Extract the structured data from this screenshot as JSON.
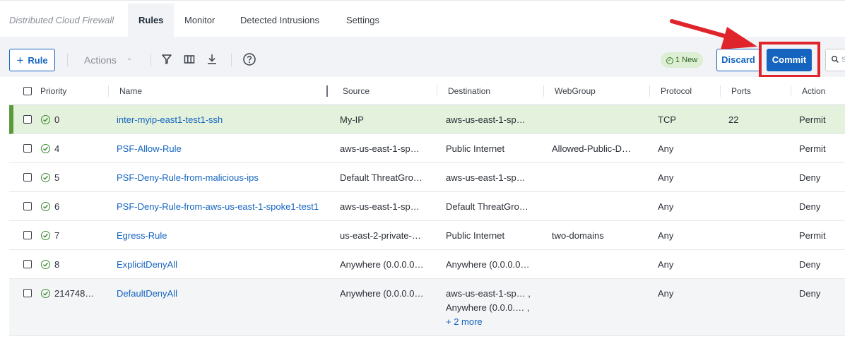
{
  "header": {
    "app_title": "Distributed Cloud Firewall",
    "tabs": [
      {
        "label": "Rules",
        "active": true
      },
      {
        "label": "Monitor",
        "active": false
      },
      {
        "label": "Detected Intrusions",
        "active": false
      },
      {
        "label": "Settings",
        "active": false
      }
    ]
  },
  "toolbar": {
    "add_rule_label": "Rule",
    "actions_label": "Actions",
    "new_badge": "1 New",
    "discard_label": "Discard",
    "commit_label": "Commit",
    "search_placeholder": "S",
    "icons": [
      "filter-icon",
      "columns-icon",
      "download-icon",
      "help-icon"
    ]
  },
  "annotation": {
    "color": "#e0242c",
    "points_to": "Commit"
  },
  "table": {
    "columns": [
      "Priority",
      "Name",
      "Source",
      "Destination",
      "WebGroup",
      "Protocol",
      "Ports",
      "Action"
    ],
    "rows": [
      {
        "priority": "0",
        "name": "inter-myip-east1-test1-ssh",
        "source": "My-IP",
        "destination": [
          "aws-us-east-1-sp…"
        ],
        "more": "",
        "webgroup": "",
        "protocol": "TCP",
        "ports": "22",
        "action": "Permit",
        "is_new": true
      },
      {
        "priority": "4",
        "name": "PSF-Allow-Rule",
        "source": "aws-us-east-1-sp…",
        "destination": [
          "Public Internet"
        ],
        "more": "",
        "webgroup": "Allowed-Public-D…",
        "protocol": "Any",
        "ports": "",
        "action": "Permit"
      },
      {
        "priority": "5",
        "name": "PSF-Deny-Rule-from-malicious-ips",
        "source": "Default ThreatGro…",
        "destination": [
          "aws-us-east-1-sp…"
        ],
        "more": "",
        "webgroup": "",
        "protocol": "Any",
        "ports": "",
        "action": "Deny"
      },
      {
        "priority": "6",
        "name": "PSF-Deny-Rule-from-aws-us-east-1-spoke1-test1",
        "source": "aws-us-east-1-sp…",
        "destination": [
          "Default ThreatGro…"
        ],
        "more": "",
        "webgroup": "",
        "protocol": "Any",
        "ports": "",
        "action": "Deny"
      },
      {
        "priority": "7",
        "name": "Egress-Rule",
        "source": "us-east-2-private-…",
        "destination": [
          "Public Internet"
        ],
        "more": "",
        "webgroup": "two-domains",
        "protocol": "Any",
        "ports": "",
        "action": "Permit"
      },
      {
        "priority": "8",
        "name": "ExplicitDenyAll",
        "source": "Anywhere (0.0.0.0…",
        "destination": [
          "Anywhere (0.0.0.0…"
        ],
        "more": "",
        "webgroup": "",
        "protocol": "Any",
        "ports": "",
        "action": "Deny"
      },
      {
        "priority": "214748…",
        "name": "DefaultDenyAll",
        "source": "Anywhere (0.0.0.0…",
        "destination": [
          "aws-us-east-1-sp… ,",
          "Anywhere (0.0.0.… ,"
        ],
        "more": "+ 2 more",
        "webgroup": "",
        "protocol": "Any",
        "ports": "",
        "action": "Deny"
      }
    ]
  }
}
